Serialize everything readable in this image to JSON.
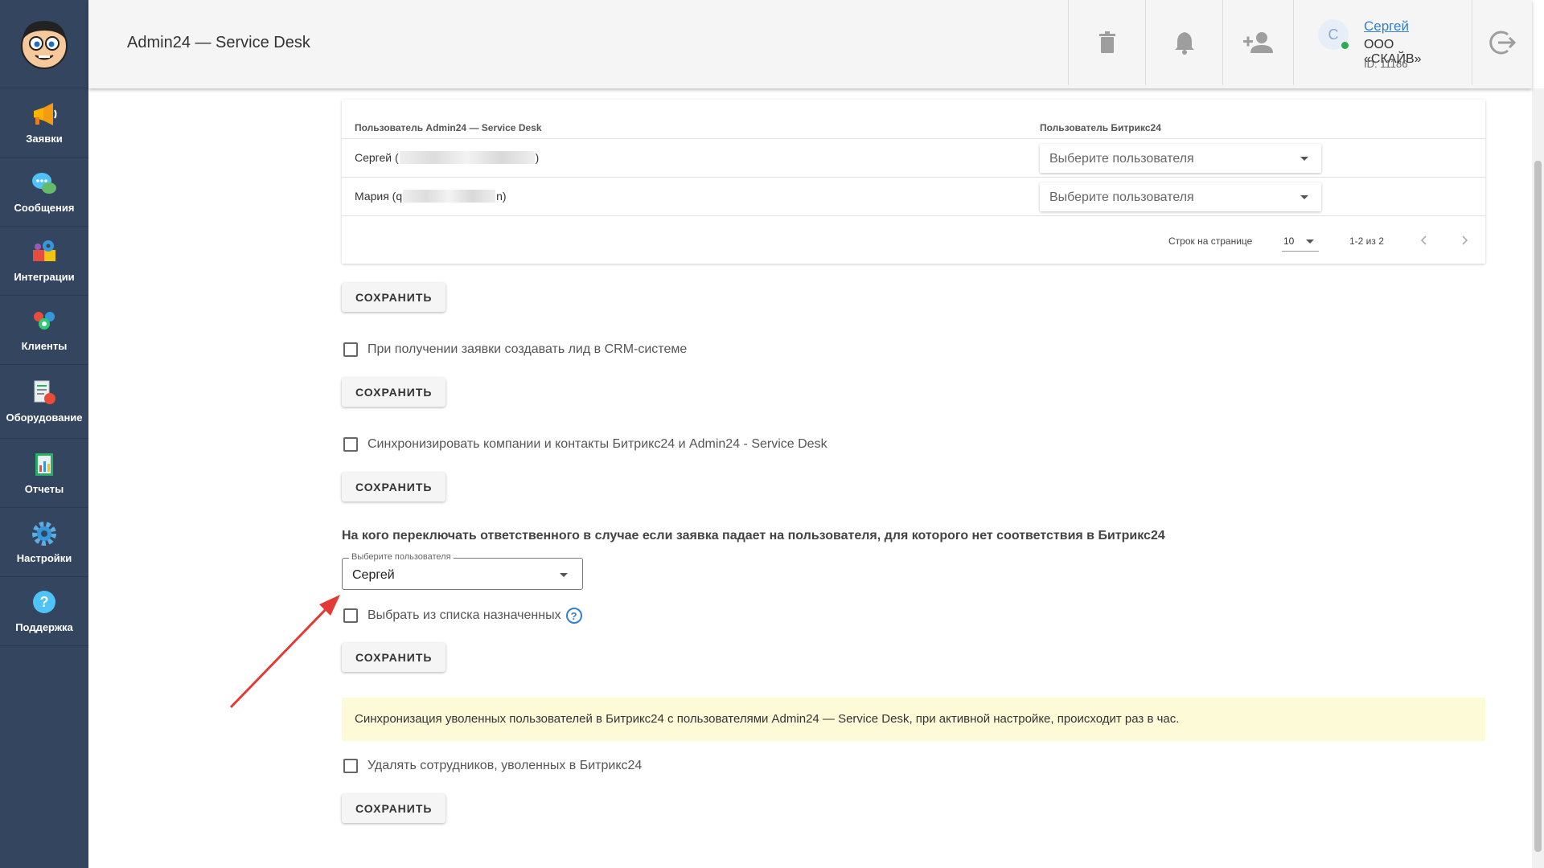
{
  "sidebar": {
    "items": [
      {
        "label": "Заявки",
        "icon": "megaphone-icon"
      },
      {
        "label": "Сообщения",
        "icon": "chat-bubbles-icon"
      },
      {
        "label": "Интеграции",
        "icon": "puzzle-gears-icon"
      },
      {
        "label": "Клиенты",
        "icon": "people-icon"
      },
      {
        "label": "Оборудование",
        "icon": "equipment-icon"
      },
      {
        "label": "Отчеты",
        "icon": "report-icon"
      },
      {
        "label": "Настройки",
        "icon": "gear-icon"
      },
      {
        "label": "Поддержка",
        "icon": "help-bubble-icon"
      }
    ]
  },
  "header": {
    "title": "Admin24 — Service Desk",
    "user": {
      "avatar_letter": "С",
      "name": "Сергей",
      "company": "ООО «СКАЙВ»",
      "id": "ID: 11186"
    }
  },
  "table": {
    "columns": [
      "Пользователь Admin24 — Service Desk",
      "Пользователь Битрикс24"
    ],
    "rows": [
      {
        "name_prefix": "Сергей (",
        "name_suffix": ")",
        "select_placeholder": "Выберите пользователя"
      },
      {
        "name_prefix": "Мария (q",
        "name_suffix": "n)",
        "select_placeholder": "Выберите пользователя"
      }
    ],
    "pager": {
      "rows_per_page_label": "Строк на странице",
      "rows_per_page": "10",
      "range": "1-2 из 2"
    }
  },
  "save_label": "СОХРАНИТЬ",
  "options": {
    "create_lead": "При получении заявки создавать лид в CRM-системе",
    "sync_companies": "Синхронизировать компании и контакты Битрикс24 и Admin24 - Service Desk",
    "choose_from_assigned": "Выбрать из списка назначенных",
    "delete_fired": "Удалять сотрудников, уволенных в Битрикс24"
  },
  "fallback": {
    "heading": "На кого переключать ответственного в случае если заявка падает на пользователя, для которого нет соответствия в Битрикс24",
    "select_legend": "Выберите пользователя",
    "select_value": "Сергей"
  },
  "notice": "Синхронизация уволенных пользователей в Битрикс24 с пользователями Admin24 — Service Desk, при активной настройке, происходит раз в час.",
  "colors": {
    "sidebar": "#34465f",
    "link": "#2f80d1",
    "notice_bg": "#fdfbd7",
    "arrow": "#e53935"
  }
}
